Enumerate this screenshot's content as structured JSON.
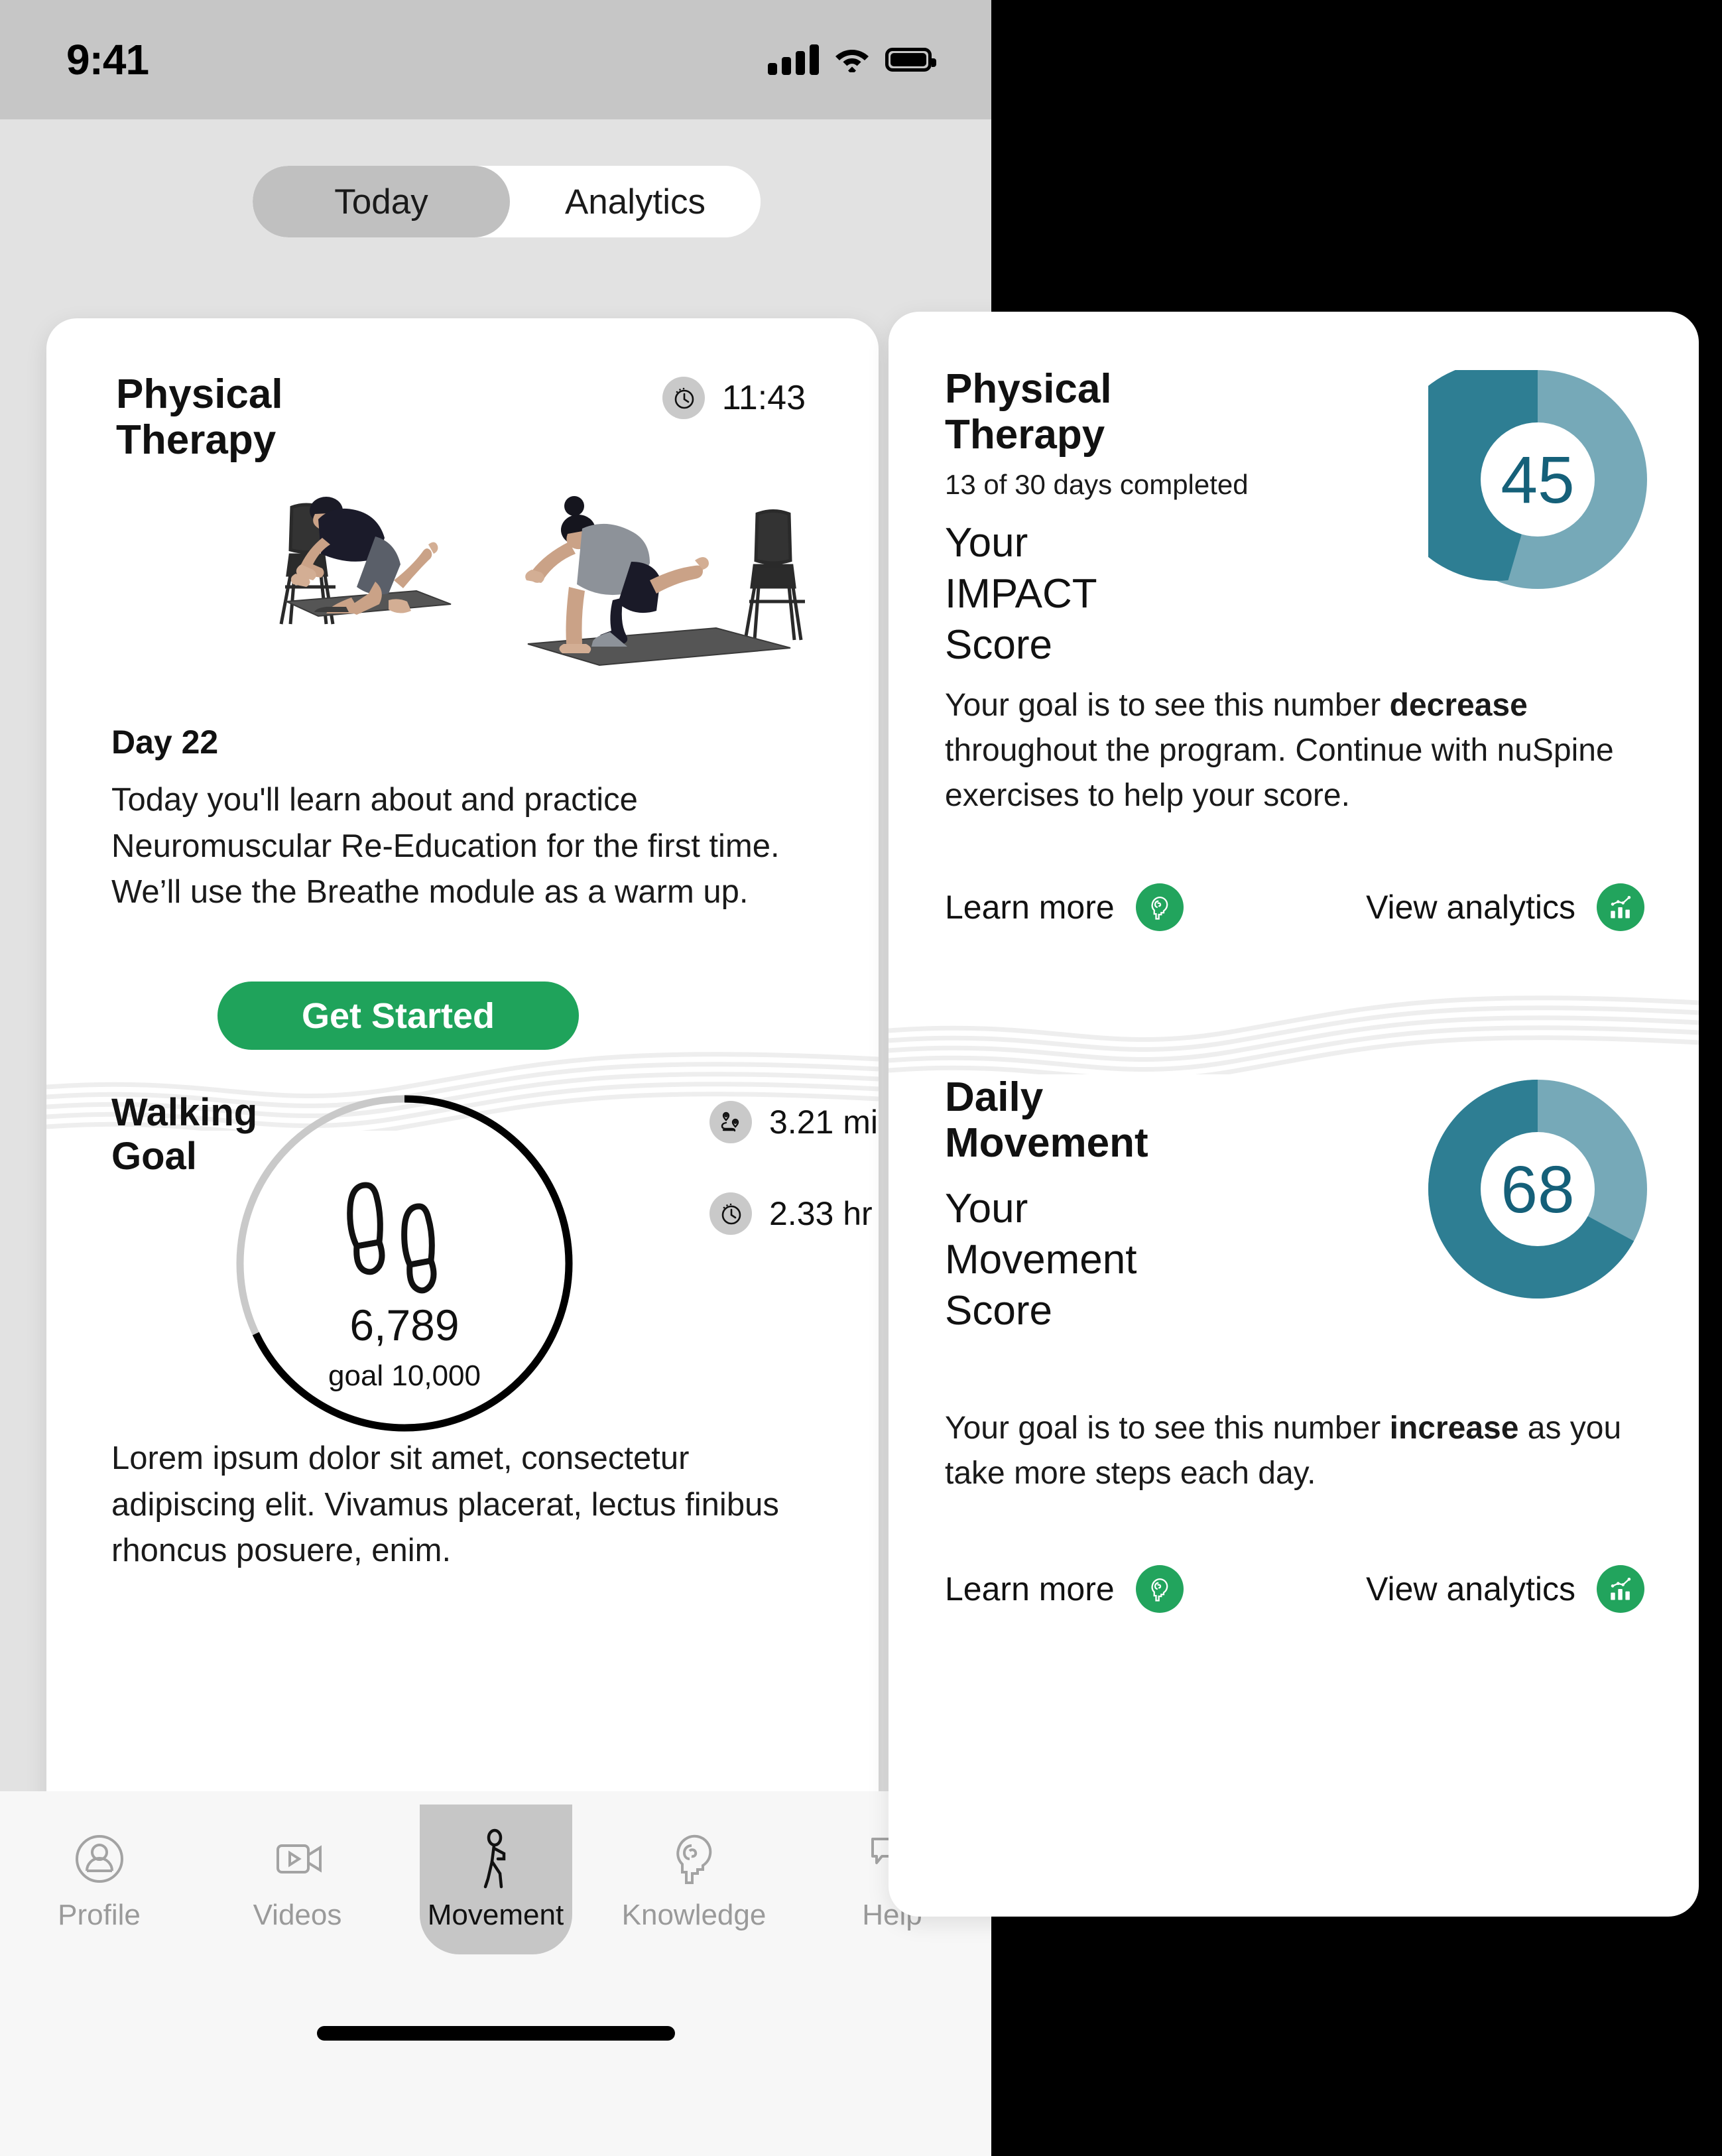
{
  "status_bar": {
    "time": "9:41",
    "icons": [
      "signal-icon",
      "wifi-icon",
      "battery-icon"
    ]
  },
  "segmented_control": {
    "options": [
      "Today",
      "Analytics"
    ],
    "selected": "Today"
  },
  "left_card": {
    "physical_therapy": {
      "title": "Physical\nTherapy",
      "title_line1": "Physical",
      "title_line2": "Therapy",
      "timer_icon": "timer-icon",
      "timer_value": "11:43",
      "image_alt": "two people performing bird-dog exercise on yoga mats beside folding chairs",
      "day_label": "Day 22",
      "description": "Today you'll learn about and practice Neuromuscular Re-Education for the first time. We’ll use the Breathe module as a warm up.",
      "cta_label": "Get Started",
      "cta_color": "#1fa35b"
    },
    "walking_goal": {
      "title_line1": "Walking",
      "title_line2": "Goal",
      "steps": "6,789",
      "goal_label": "goal 10,000",
      "steps_value": 6789,
      "goal_value": 10000,
      "progress_percent": 68,
      "ring_color": "#000000",
      "ring_track_color": "#c9c9c9",
      "center_icon": "footsteps-icon",
      "stats": [
        {
          "icon": "route-icon",
          "value": "3.21 mi"
        },
        {
          "icon": "timer-icon",
          "value": "2.33 hr"
        }
      ],
      "description": "Lorem ipsum dolor sit amet, consectetur adipiscing elit. Vivamus placerat, lectus finibus rhoncus posuere, enim."
    }
  },
  "right_card": {
    "impact": {
      "title_line1": "Physical",
      "title_line2": "Therapy",
      "subtitle": "13 of 30 days completed",
      "score_label_line1": "Your",
      "score_label_line2": "IMPACT",
      "score_label_line3": "Score",
      "score": "45",
      "score_value": 45,
      "donut_fill_percent": 58,
      "donut_color_dark": "#2e7e93",
      "donut_color_light": "#76a9b8",
      "score_text_color": "#156079",
      "description_pre": "Your goal is to see this number ",
      "description_bold": "decrease",
      "description_post": " throughout the program. Continue with nuSpine exercises to help your score.",
      "actions": [
        {
          "label": "Learn more",
          "icon": "brain-head-icon"
        },
        {
          "label": "View analytics",
          "icon": "bar-chart-icon"
        }
      ]
    },
    "movement": {
      "title_line1": "Daily",
      "title_line2": "Movement",
      "score_label_line1": "Your",
      "score_label_line2": "Movement",
      "score_label_line3": "Score",
      "score": "68",
      "score_value": 68,
      "donut_fill_percent": 68,
      "donut_color_dark": "#2e7e93",
      "donut_color_light": "#76a9b8",
      "score_text_color": "#156079",
      "description_pre": "Your goal is to see this number ",
      "description_bold": "increase",
      "description_post": " as you take more steps each day.",
      "actions": [
        {
          "label": "Learn more",
          "icon": "brain-head-icon"
        },
        {
          "label": "View analytics",
          "icon": "bar-chart-icon"
        }
      ]
    }
  },
  "tab_bar": {
    "items": [
      {
        "label": "Profile",
        "icon": "person-circle-icon",
        "active": false
      },
      {
        "label": "Videos",
        "icon": "video-camera-icon",
        "active": false
      },
      {
        "label": "Movement",
        "icon": "walking-person-icon",
        "active": true
      },
      {
        "label": "Knowledge",
        "icon": "brain-head-icon",
        "active": false
      },
      {
        "label": "Help",
        "icon": "chat-bubbles-icon",
        "active": false
      }
    ]
  },
  "colors": {
    "accent_green": "#1fa35b",
    "teal_dark": "#2e7e93",
    "teal_light": "#76a9b8",
    "app_background": "#e2e2e2",
    "card_background": "#ffffff"
  }
}
